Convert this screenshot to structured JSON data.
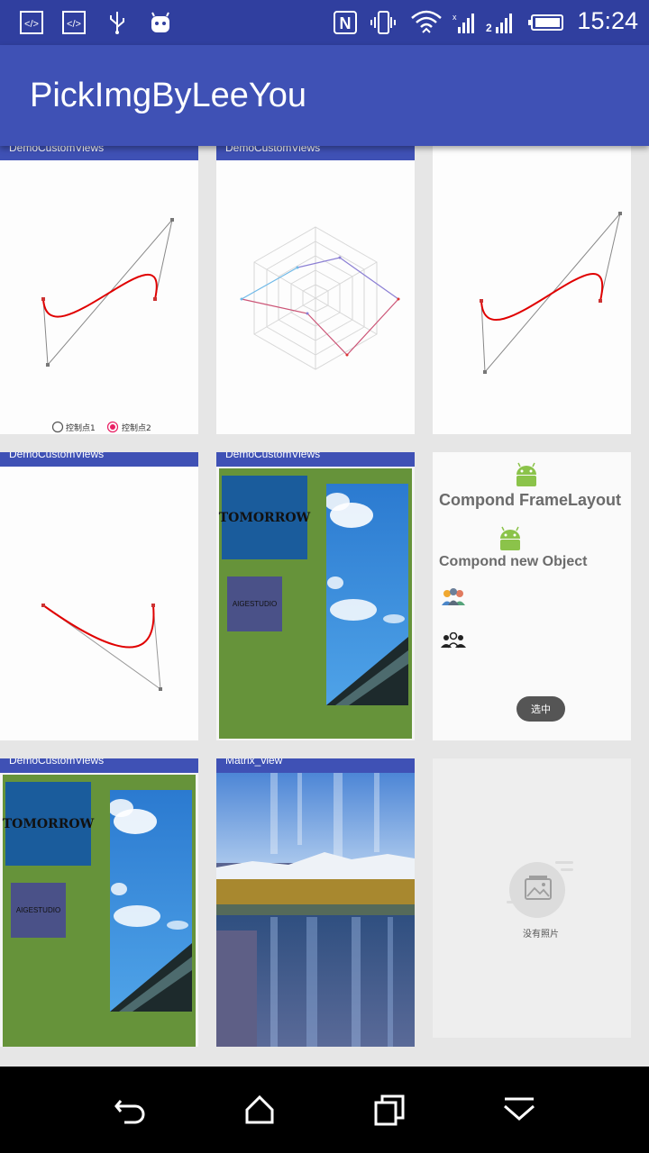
{
  "status": {
    "time": "15:24"
  },
  "app": {
    "title": "PickImgByLeeYou"
  },
  "tiles": {
    "t1": {
      "bar": "DemoCustomViews",
      "radio1": "控制点1",
      "radio2": "控制点2"
    },
    "t2": {
      "bar": "DemoCustomViews"
    },
    "t4": {
      "bar": "DemoCustomViews"
    },
    "t5": {
      "bar": "DemoCustomViews",
      "tomorrow": "TOMORROW",
      "aige": "AIGESTUDIO"
    },
    "t6": {
      "title1": "Compond FrameLayout",
      "title2": "Compond new Object",
      "button": "选中"
    },
    "t7": {
      "bar": "DemoCustomViews",
      "tomorrow": "TOMORROW",
      "aige": "AIGESTUDIO"
    },
    "t8": {
      "bar": "Matrix_view"
    },
    "t9": {
      "empty": "没有照片"
    }
  },
  "colors": {
    "statusbar": "#303f9f",
    "appbar": "#3f51b5",
    "curve": "#e00000",
    "green": "#66933a"
  }
}
